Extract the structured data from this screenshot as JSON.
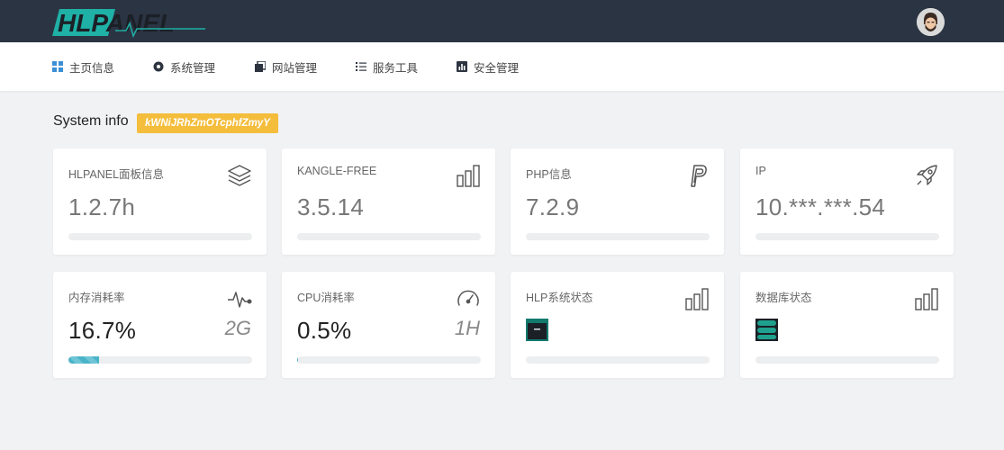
{
  "header": {
    "logo_text": "HLPANEL",
    "avatar_name": "user-avatar"
  },
  "nav": {
    "items": [
      {
        "label": "主页信息",
        "icon": "dashboard-icon"
      },
      {
        "label": "系统管理",
        "icon": "gear-icon"
      },
      {
        "label": "网站管理",
        "icon": "copy-icon"
      },
      {
        "label": "服务工具",
        "icon": "list-icon"
      },
      {
        "label": "安全管理",
        "icon": "chart-icon"
      }
    ]
  },
  "system_info": {
    "title": "System info",
    "key": "kWNiJRhZmOTcphfZmyY"
  },
  "cards": [
    {
      "label": "HLPANEL面板信息",
      "value": "1.2.7h",
      "icon": "layers-icon"
    },
    {
      "label": "KANGLE-FREE",
      "value": "3.5.14",
      "icon": "bar-chart-icon"
    },
    {
      "label": "PHP信息",
      "value": "7.2.9",
      "icon": "paypal-icon"
    },
    {
      "label": "IP",
      "value": "10.***.***.54",
      "icon": "rocket-icon"
    },
    {
      "label": "内存消耗率",
      "value": "16.7%",
      "aux": "2G",
      "progress": 0.167,
      "icon": "pulse-icon"
    },
    {
      "label": "CPU消耗率",
      "value": "0.5%",
      "aux": "1H",
      "progress": 0.005,
      "icon": "speedometer-icon"
    },
    {
      "label": "HLP系统状态",
      "icon": "bar-chart-icon",
      "status_icon": "window-icon"
    },
    {
      "label": "数据库状态",
      "icon": "bar-chart-icon",
      "status_icon": "database-icon"
    }
  ],
  "colors": {
    "topbar": "#2b3443",
    "accent_teal": "#1fb0a6",
    "badge": "#f4bd3b",
    "progress": "#4ab3c8",
    "status_icon": "#127a6e"
  }
}
